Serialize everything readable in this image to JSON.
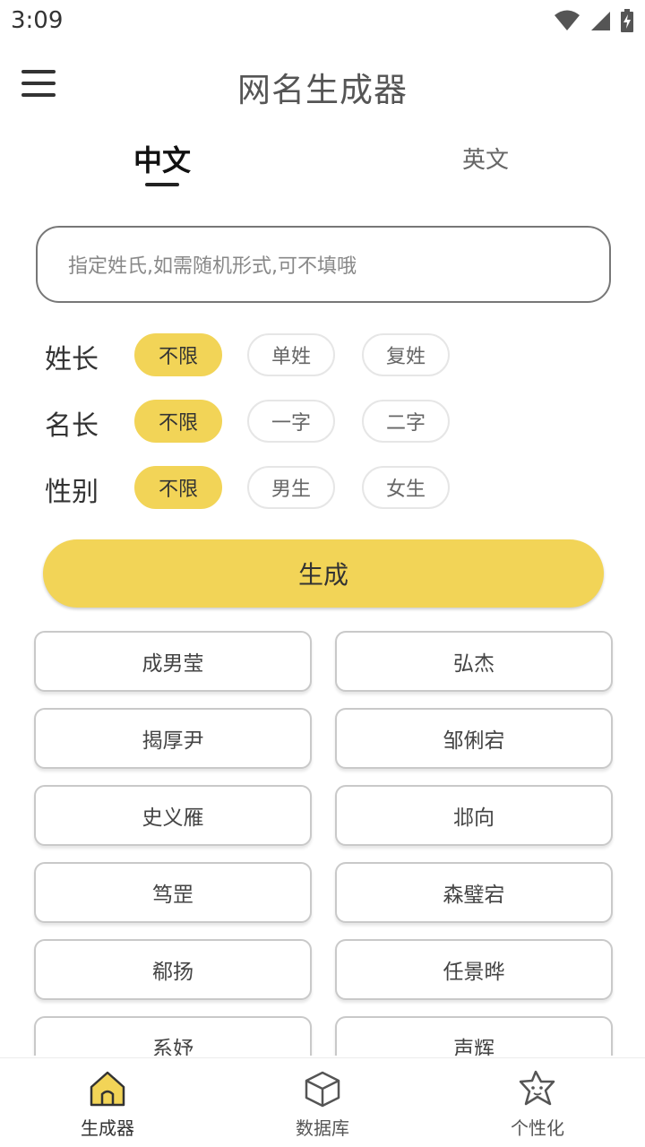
{
  "status_bar": {
    "time": "3:09"
  },
  "app_bar": {
    "title": "网名生成器"
  },
  "lang_tabs": {
    "chinese": "中文",
    "english": "英文"
  },
  "surname_input": {
    "placeholder": "指定姓氏,如需随机形式,可不填哦",
    "value": ""
  },
  "options": {
    "surname_length": {
      "label": "姓长",
      "choices": [
        "不限",
        "单姓",
        "复姓"
      ],
      "selected": "不限"
    },
    "given_length": {
      "label": "名长",
      "choices": [
        "不限",
        "一字",
        "二字"
      ],
      "selected": "不限"
    },
    "gender": {
      "label": "性别",
      "choices": [
        "不限",
        "男生",
        "女生"
      ],
      "selected": "不限"
    }
  },
  "generate_label": "生成",
  "results": [
    "成男莹",
    "弘杰",
    "揭厚尹",
    "邹俐宕",
    "史义雁",
    "邶向",
    "笃罡",
    "森璧宕",
    "郗扬",
    "任景晔",
    "系妤",
    "声辉"
  ],
  "bottom_nav": {
    "generator": "生成器",
    "database": "数据库",
    "personalize": "个性化"
  },
  "colors": {
    "accent": "#f2d457",
    "text": "#333333",
    "border": "#c9c9c9"
  }
}
